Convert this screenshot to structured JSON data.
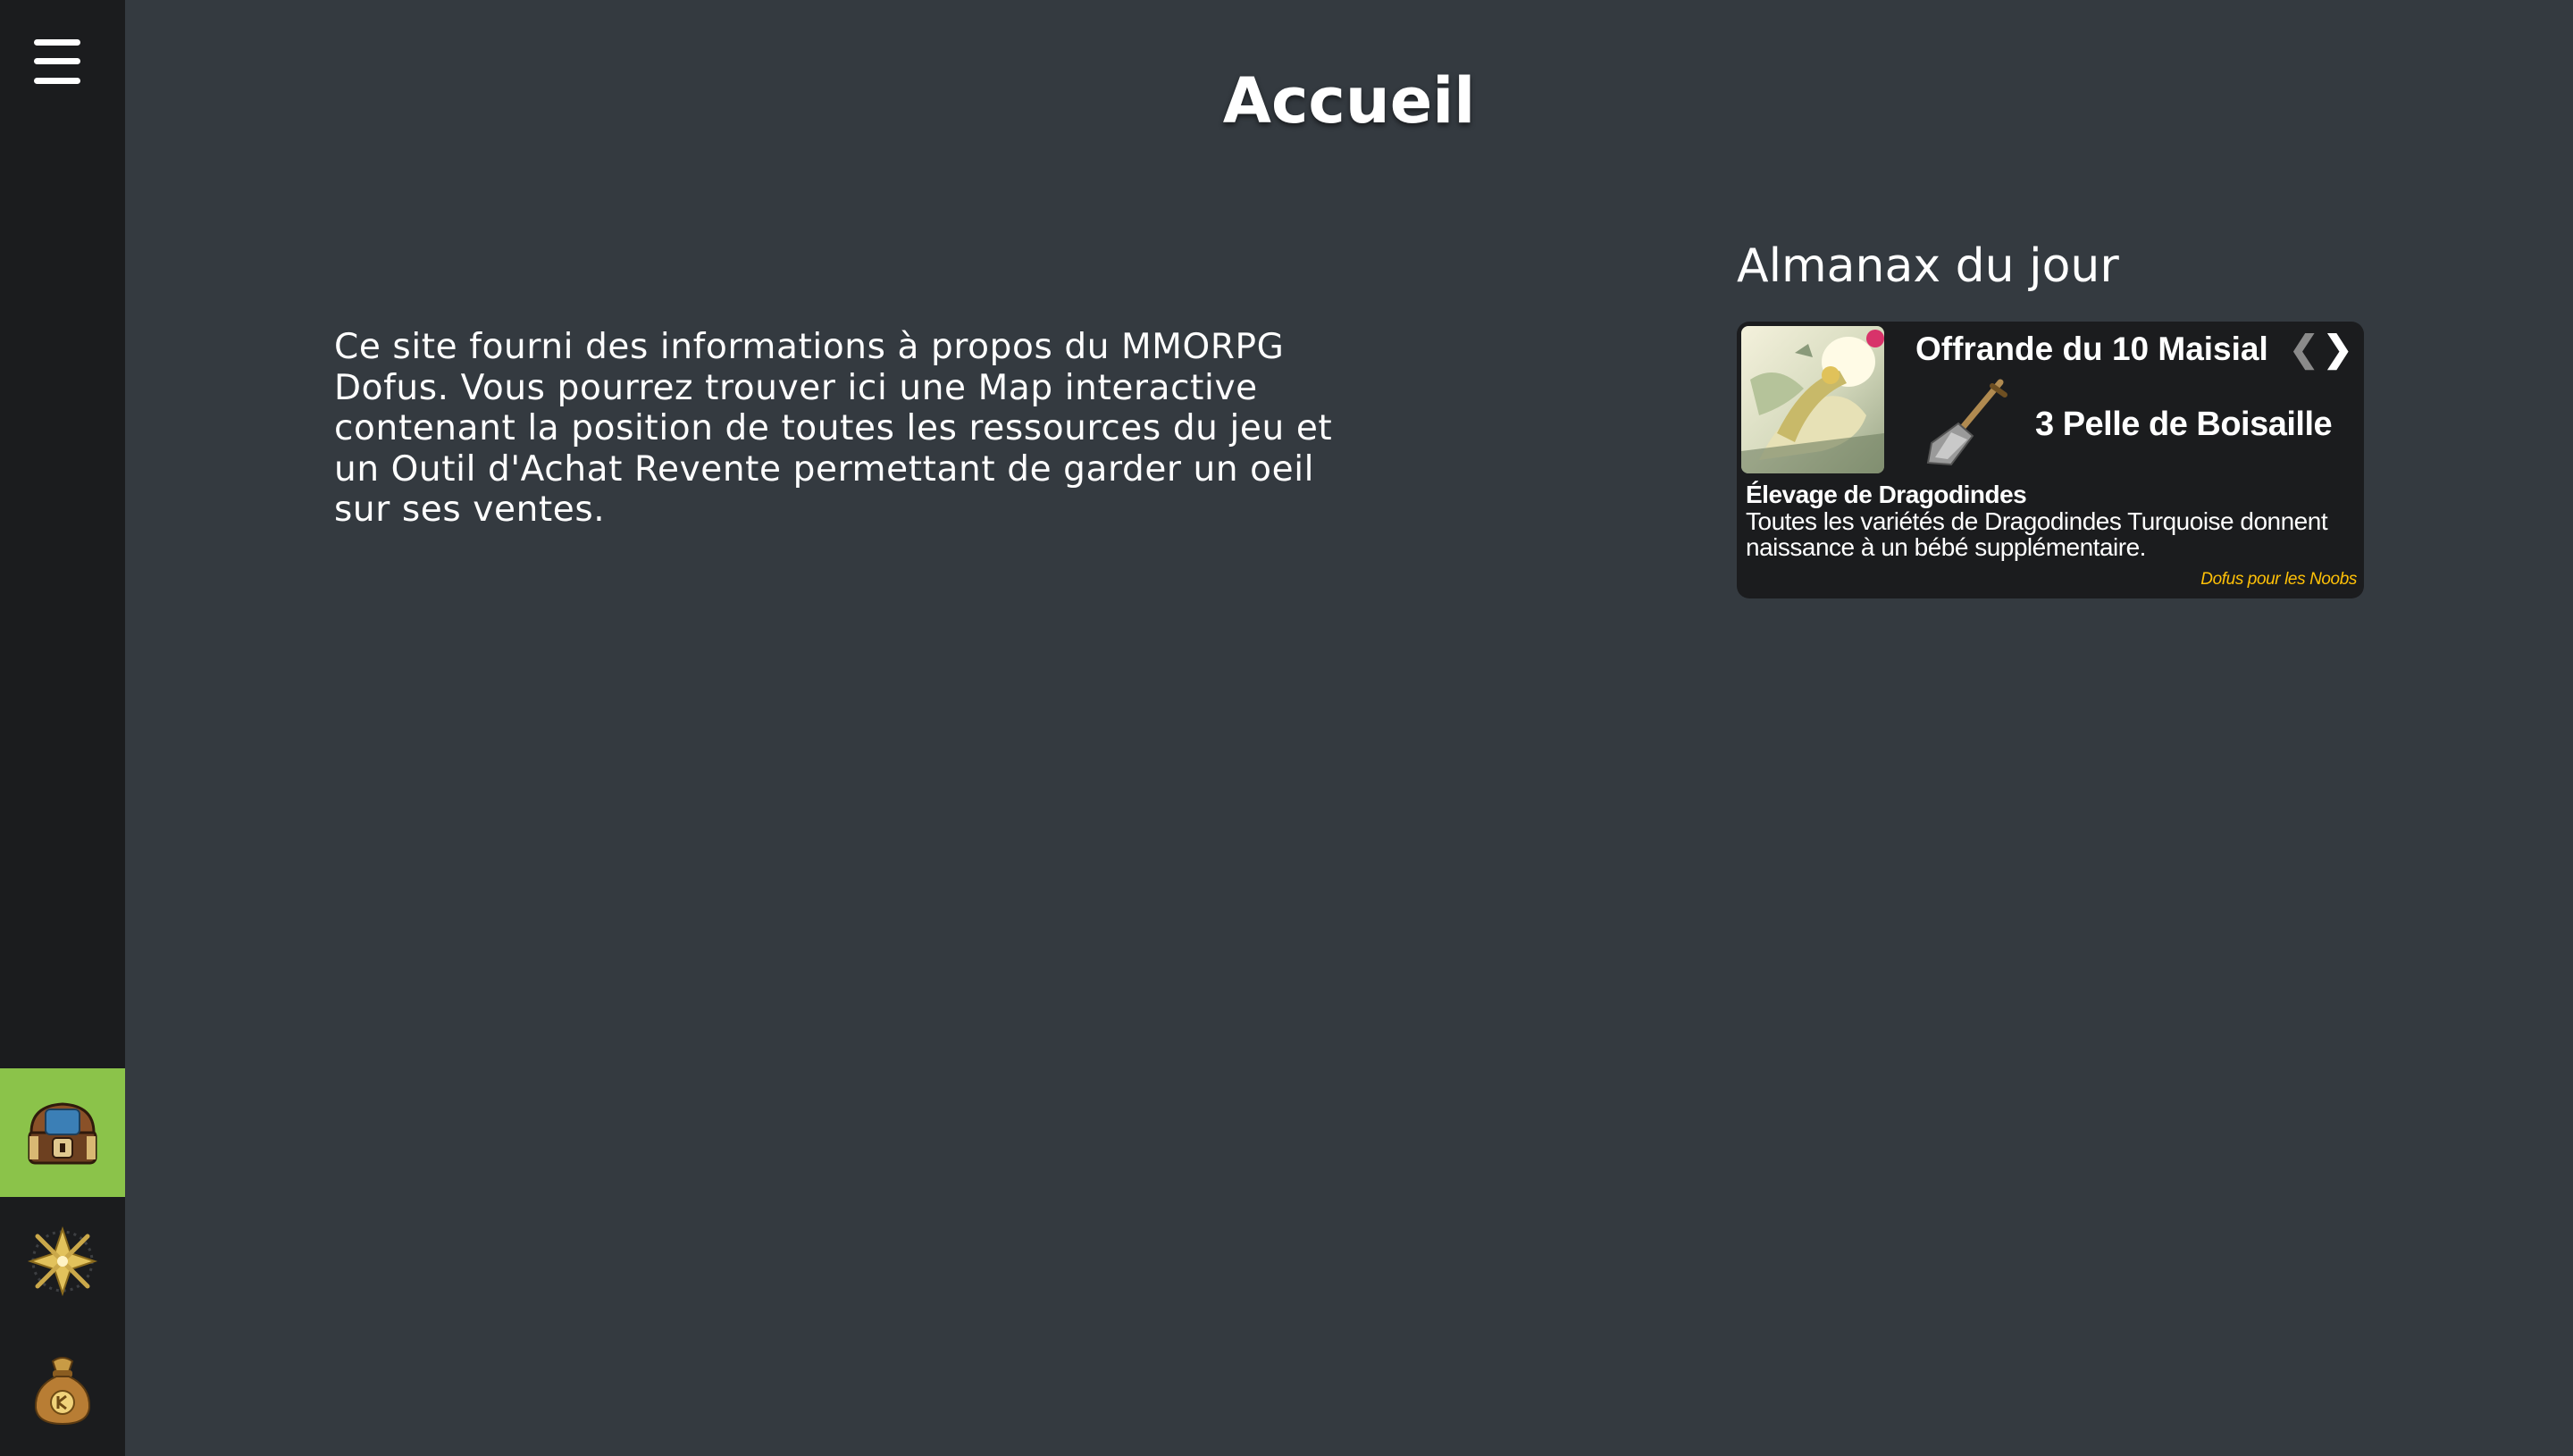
{
  "page": {
    "title": "Accueil"
  },
  "intro": {
    "text": "Ce site fourni des informations à propos du MMORPG Dofus. Vous pourrez trouver ici une Map interactive contenant la position de toutes les ressources du jeu et un Outil d'Achat Revente permettant de garder un oeil sur ses ventes."
  },
  "sidebar": {
    "menu_icon": "hamburger-menu-icon",
    "items": [
      {
        "icon": "treasure-chest-icon",
        "active": true
      },
      {
        "icon": "compass-star-icon",
        "active": false
      },
      {
        "icon": "kamas-bag-icon",
        "active": false
      }
    ],
    "active_color": "#8bc34a"
  },
  "almanax": {
    "heading": "Almanax du jour",
    "offering_title": "Offrande du 10 Maisial",
    "prev_arrow": "❮",
    "next_arrow": "❯",
    "item_icon": "shovel-icon",
    "item": "3 Pelle de Boisaille",
    "bonus_title": "Élevage de Dragodindes",
    "bonus_description": "Toutes les variétés de Dragodindes Turquoise donnent naissance à un bébé supplémentaire.",
    "source": "Dofus pour les Noobs",
    "source_color": "#ffc107"
  }
}
